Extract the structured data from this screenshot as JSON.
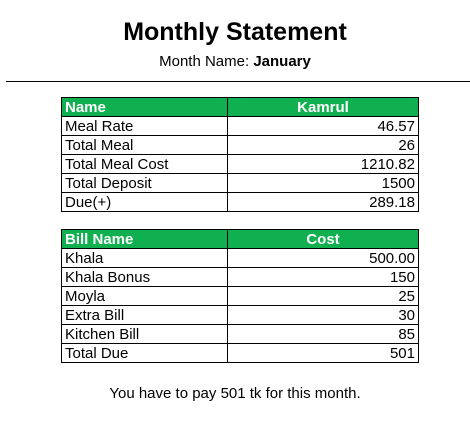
{
  "statement": {
    "title": "Monthly Statement",
    "month_label": "Month Name:",
    "month_value": "January"
  },
  "summary_table": {
    "headers": [
      "Name",
      "Kamrul"
    ],
    "rows": [
      {
        "label": "Meal Rate",
        "value": "46.57"
      },
      {
        "label": "Total Meal",
        "value": "26"
      },
      {
        "label": "Total Meal Cost",
        "value": "1210.82"
      },
      {
        "label": "Total Deposit",
        "value": "1500"
      },
      {
        "label": "Due(+)",
        "value": "289.18"
      }
    ]
  },
  "bills_table": {
    "headers": [
      "Bill Name",
      "Cost"
    ],
    "rows": [
      {
        "label": "Khala",
        "value": "500.00"
      },
      {
        "label": "Khala Bonus",
        "value": "150"
      },
      {
        "label": "Moyla",
        "value": "25"
      },
      {
        "label": "Extra Bill",
        "value": "30"
      },
      {
        "label": "Kitchen Bill",
        "value": "85"
      },
      {
        "label": "Total Due",
        "value": "501"
      }
    ]
  },
  "footer_text": "You have to pay 501 tk for this month.",
  "colors": {
    "header_bg": "#10b050",
    "header_text": "#ffffff"
  }
}
